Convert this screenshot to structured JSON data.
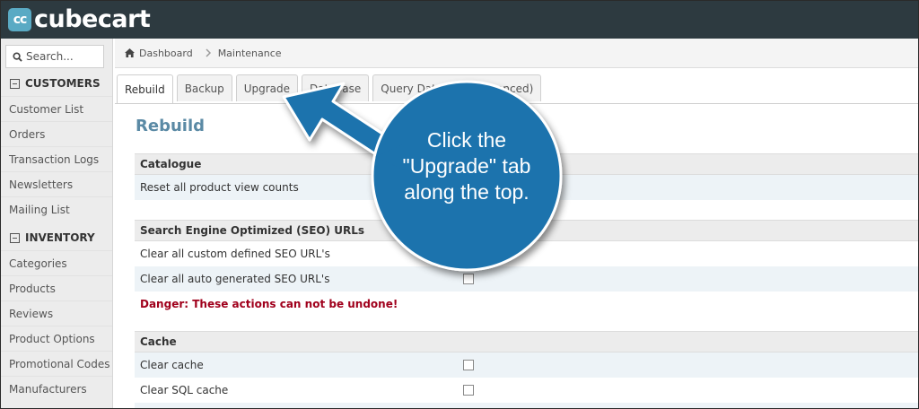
{
  "app": {
    "logo_mark": "cc",
    "name": "cubecart"
  },
  "sidebar": {
    "search_placeholder": "Search...",
    "sections": [
      {
        "title": "CUSTOMERS",
        "items": [
          "Customer List",
          "Orders",
          "Transaction Logs",
          "Newsletters",
          "Mailing List"
        ]
      },
      {
        "title": "INVENTORY",
        "items": [
          "Categories",
          "Products",
          "Reviews",
          "Product Options",
          "Promotional Codes",
          "Manufacturers"
        ]
      }
    ]
  },
  "breadcrumb": {
    "home": "Dashboard",
    "current": "Maintenance"
  },
  "tabs": [
    "Rebuild",
    "Backup",
    "Upgrade",
    "Database",
    "Query Database (Advanced)"
  ],
  "active_tab": "Rebuild",
  "page_title": "Rebuild",
  "groups": {
    "catalogue": {
      "title": "Catalogue",
      "rows": [
        "Reset all product view counts"
      ]
    },
    "seo": {
      "title": "Search Engine Optimized (SEO) URLs",
      "rows": [
        "Clear all custom defined SEO URL's",
        "Clear all auto generated SEO URL's"
      ]
    },
    "danger": "Danger: These actions can not be undone!",
    "cache": {
      "title": "Cache",
      "rows": [
        "Clear cache",
        "Clear SQL cache"
      ]
    }
  },
  "callout": {
    "line1": "Click the",
    "line2": "\"Upgrade\" tab",
    "line3": "along the top.",
    "color": "#1c73ad"
  }
}
